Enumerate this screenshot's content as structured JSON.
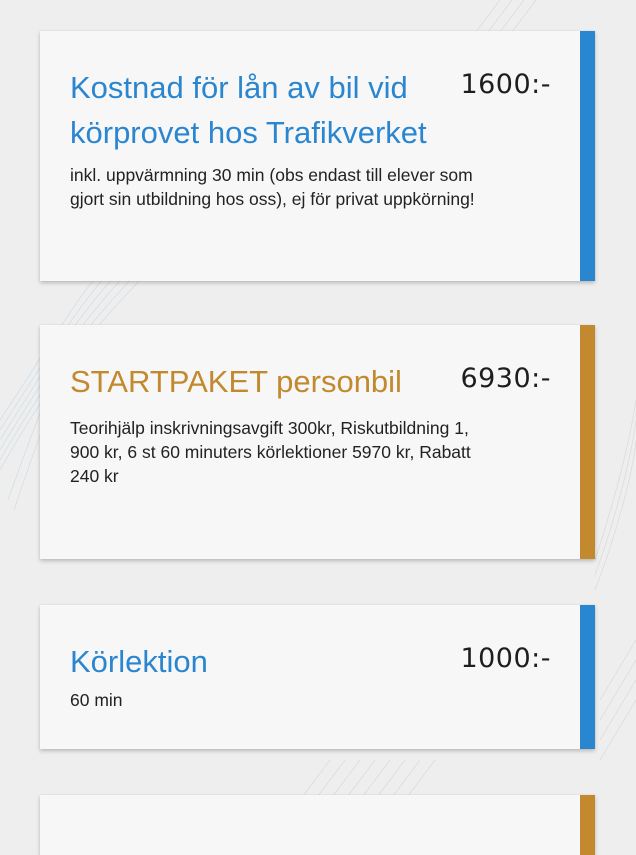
{
  "colors": {
    "page_background": "#eeeeee",
    "card_background": "#f7f7f7",
    "blue_accent": "#2b86d0",
    "gold_accent": "#c2892e",
    "price_text": "#1e1e1e"
  },
  "cards": [
    {
      "title": "Kostnad för lån av bil vid körprovet hos Trafikverket",
      "price": "1600:-",
      "description": "inkl. uppvärmning 30 min (obs endast till elever som gjort sin utbildning hos oss), ej för privat uppkörning!",
      "accent": "#2b86d0"
    },
    {
      "title": "STARTPAKET personbil",
      "price": "6930:-",
      "description": "Teorihjälp inskrivningsavgift 300kr, Riskutbildning 1, 900 kr, 6 st 60 minuters körlektioner 5970 kr, Rabatt 240 kr",
      "accent": "#c2892e"
    },
    {
      "title": "Körlektion",
      "price": "1000:-",
      "description": "60 min",
      "accent": "#2b86d0"
    },
    {
      "accent": "#c2892e"
    }
  ]
}
